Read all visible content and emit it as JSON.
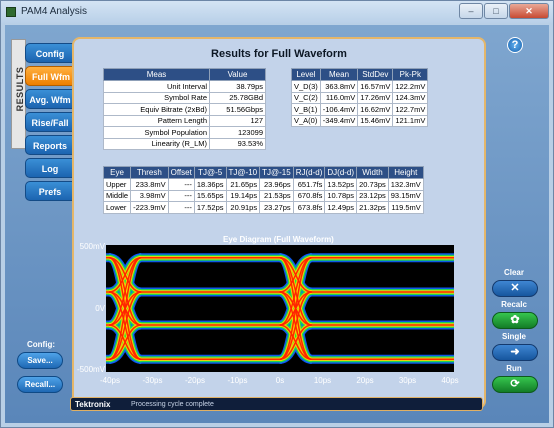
{
  "window": {
    "title": "PAM4 Analysis",
    "minimize": "–",
    "maximize": "□",
    "close": "✕"
  },
  "sidebar": {
    "results_label": "RESULTS",
    "tabs": [
      {
        "label": "Config"
      },
      {
        "label": "Full Wfm",
        "active": true
      },
      {
        "label": "Avg. Wfm"
      },
      {
        "label": "Rise/Fall"
      },
      {
        "label": "Reports"
      },
      {
        "label": "Log"
      },
      {
        "label": "Prefs"
      }
    ],
    "config_label": "Config:",
    "save_label": "Save...",
    "recall_label": "Recall..."
  },
  "help": {
    "label": "?"
  },
  "results": {
    "title": "Results for Full Waveform",
    "meas_table": {
      "headers": [
        "Meas",
        "Value"
      ],
      "rows": [
        [
          "Unit Interval",
          "38.79ps"
        ],
        [
          "Symbol Rate",
          "25.78GBd"
        ],
        [
          "Equiv Bitrate (2xBd)",
          "51.56Gbps"
        ],
        [
          "Pattern Length",
          "127"
        ],
        [
          "Symbol Population",
          "123099"
        ],
        [
          "Linearity (R_LM)",
          "93.53%"
        ]
      ]
    },
    "level_table": {
      "headers": [
        "Level",
        "Mean",
        "StdDev",
        "Pk-Pk"
      ],
      "rows": [
        [
          "V_D(3)",
          "363.8mV",
          "16.57mV",
          "122.2mV"
        ],
        [
          "V_C(2)",
          "116.0mV",
          "17.26mV",
          "124.3mV"
        ],
        [
          "V_B(1)",
          "-106.4mV",
          "16.62mV",
          "122.7mV"
        ],
        [
          "V_A(0)",
          "-349.4mV",
          "15.46mV",
          "121.1mV"
        ]
      ]
    },
    "eye_table": {
      "headers": [
        "Eye",
        "Thresh",
        "Offset",
        "TJ@-5",
        "TJ@-10",
        "TJ@-15",
        "RJ(d-d)",
        "DJ(d-d)",
        "Width",
        "Height"
      ],
      "rows": [
        [
          "Upper",
          "233.8mV",
          "---",
          "18.36ps",
          "21.65ps",
          "23.96ps",
          "651.7fs",
          "13.52ps",
          "20.73ps",
          "132.3mV"
        ],
        [
          "Middle",
          "3.98mV",
          "---",
          "15.65ps",
          "19.14ps",
          "21.53ps",
          "670.8fs",
          "10.78ps",
          "23.12ps",
          "93.15mV"
        ],
        [
          "Lower",
          "-223.9mV",
          "---",
          "17.52ps",
          "20.91ps",
          "23.27ps",
          "673.8fs",
          "12.49ps",
          "21.32ps",
          "119.5mV"
        ]
      ]
    }
  },
  "eye_diagram": {
    "title": "Eye Diagram (Full Waveform)",
    "y_ticks": [
      "500mV",
      "0V",
      "-500mV"
    ],
    "x_ticks": [
      "-40ps",
      "-30ps",
      "-20ps",
      "-10ps",
      "0s",
      "10ps",
      "20ps",
      "30ps",
      "40ps"
    ],
    "colors": {
      "background": "#000000",
      "hot": "#ff2000",
      "warm": "#ffd000",
      "mid": "#20e040",
      "cool": "#1060ff"
    }
  },
  "status": {
    "brand": "Tektronix",
    "message": "Processing cycle complete"
  },
  "controls": {
    "clear_label": "Clear",
    "clear_icon": "close-icon",
    "recalc_label": "Recalc",
    "recalc_icon": "recalc-icon",
    "single_label": "Single",
    "single_icon": "arrow-right-icon",
    "run_label": "Run",
    "run_icon": "refresh-icon"
  }
}
